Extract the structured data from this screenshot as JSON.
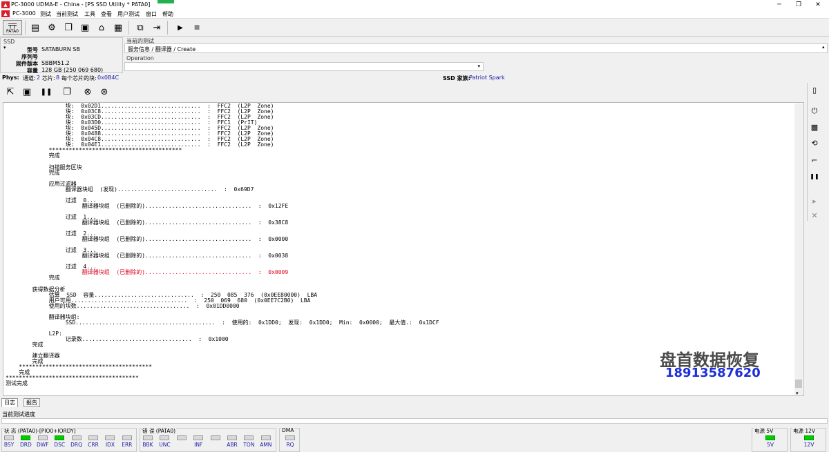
{
  "window": {
    "title": "PC-3000 UDMA-E - China - [PS SSD Utility * PATA0]",
    "minimize": "─",
    "maximize": "❐",
    "close": "✕"
  },
  "menu": {
    "app": "PC-3000",
    "items": [
      "测试",
      "当前测试",
      "工具",
      "查看",
      "用户测试",
      "窗口",
      "帮助"
    ]
  },
  "toolbar": {
    "pata_label": "PATA0"
  },
  "ssd": {
    "header": "SSD",
    "model_label": "型号",
    "model": "SATABURN   SB",
    "serial_label": "序列号",
    "serial": "",
    "firmware_label": "固件版本",
    "firmware": "SBBM51.2",
    "capacity_label": "容量",
    "capacity": "128 GB (250 069 680)"
  },
  "current_test": {
    "header": "当前的测试",
    "path": "服务信息 / 翻译器 / Create",
    "operation_label": "Operation",
    "operation_value": ""
  },
  "phys": {
    "label": "Phys:",
    "channels_label": "通道:",
    "channels": "2",
    "chips_label": "芯片:",
    "chips": "8",
    "blocks_label": "每个芯片的块:",
    "blocks": "0x0B4C",
    "family_label": "SSD 家族:",
    "family": "Patriot Spark"
  },
  "log": {
    "lines": [
      {
        "t": "                  块:  0x02D1..............................  :  FFC2  (L2P  Zone)"
      },
      {
        "t": "                  块:  0x03C8..............................  :  FFC2  (L2P  Zone)"
      },
      {
        "t": "                  块:  0x03CD..............................  :  FFC2  (L2P  Zone)"
      },
      {
        "t": "                  块:  0x03D0..............................  :  FFC1  (PrIT)"
      },
      {
        "t": "                  块:  0x045D..............................  :  FFC2  (L2P  Zone)"
      },
      {
        "t": "                  块:  0x0488..............................  :  FFC2  (L2P  Zone)"
      },
      {
        "t": "                  块:  0x04C8..............................  :  FFC2  (L2P  Zone)"
      },
      {
        "t": "                  块:  0x04E1..............................  :  FFC2  (L2P  Zone)"
      },
      {
        "t": "             ****************************************"
      },
      {
        "t": "             完成"
      },
      {
        "t": ""
      },
      {
        "t": "             扫描服务区块"
      },
      {
        "t": "             完成"
      },
      {
        "t": ""
      },
      {
        "t": "             应用过滤器"
      },
      {
        "t": "                  翻译器块组  (发现)..............................  :  0x69D7"
      },
      {
        "t": ""
      },
      {
        "t": "                  过滤  0..."
      },
      {
        "t": "                       翻译器块组  (已删除的)................................  :  0x12FE"
      },
      {
        "t": ""
      },
      {
        "t": "                  过滤  1..."
      },
      {
        "t": "                       翻译器块组  (已删除的)................................  :  0x38C8"
      },
      {
        "t": ""
      },
      {
        "t": "                  过滤  2..."
      },
      {
        "t": "                       翻译器块组  (已删除的)................................  :  0x0000"
      },
      {
        "t": ""
      },
      {
        "t": "                  过滤  3..."
      },
      {
        "t": "                       翻译器块组  (已删除的)................................  :  0x0038"
      },
      {
        "t": ""
      },
      {
        "t": "                  过滤  4..."
      },
      {
        "t": "                       翻译器块组  (已删除的)................................  :  0x0009",
        "red": true
      },
      {
        "t": "             完成"
      },
      {
        "t": ""
      },
      {
        "t": "        获得数据分析"
      },
      {
        "t": "             估算  SSD  容量..............................  :  250  085  376  (0x0EE80000)  LBA"
      },
      {
        "t": "             用户可用...................................  :  250  069  680  (0x0EE7C2B0)  LBA"
      },
      {
        "t": "             使用的块数..................................  :  0x01DD0000"
      },
      {
        "t": ""
      },
      {
        "t": "             翻译器块组:"
      },
      {
        "t": "                  SSD..........................................  :  使用的:  0x1DD0;  发现:  0x1DD0;  Min:  0x0000;  最大值.:  0x1DCF"
      },
      {
        "t": ""
      },
      {
        "t": "             L2P:"
      },
      {
        "t": "                  记录数.................................  :  0x1000"
      },
      {
        "t": "        完成"
      },
      {
        "t": ""
      },
      {
        "t": "        建立翻译器"
      },
      {
        "t": "        完成"
      },
      {
        "t": "    ****************************************"
      },
      {
        "t": "    完成"
      },
      {
        "t": "****************************************"
      },
      {
        "t": "测试完成"
      }
    ]
  },
  "watermark": {
    "line1": "盘首数据恢复",
    "line2": "18913587620"
  },
  "tabs": [
    "日志",
    "报告"
  ],
  "progress": {
    "label": "当前测试进度"
  },
  "status": {
    "state_label": "状 态 (PATA0)-[PIO0+IORDY]",
    "state_leds": [
      {
        "name": "BSY",
        "on": false
      },
      {
        "name": "DRD",
        "on": true
      },
      {
        "name": "DWF",
        "on": false
      },
      {
        "name": "DSC",
        "on": true
      },
      {
        "name": "DRQ",
        "on": false
      },
      {
        "name": "CRR",
        "on": false
      },
      {
        "name": "IDX",
        "on": false
      },
      {
        "name": "ERR",
        "on": false
      }
    ],
    "error_label": "错 误 (PATA0)",
    "error_leds": [
      "BBK",
      "UNC",
      "",
      "INF",
      "",
      "ABR",
      "TON",
      "AMN"
    ],
    "dma_label": "DMA",
    "dma_led": "RQ",
    "power5_label": "电源 5V",
    "power5_led": "5V",
    "power12_label": "电源 12V",
    "power12_led": "12V",
    "colors": {
      "led_on": "#00cc00",
      "led_off": "#d8d8d8",
      "error_red": "#e0001a",
      "link_blue": "#1c1ca8"
    }
  }
}
